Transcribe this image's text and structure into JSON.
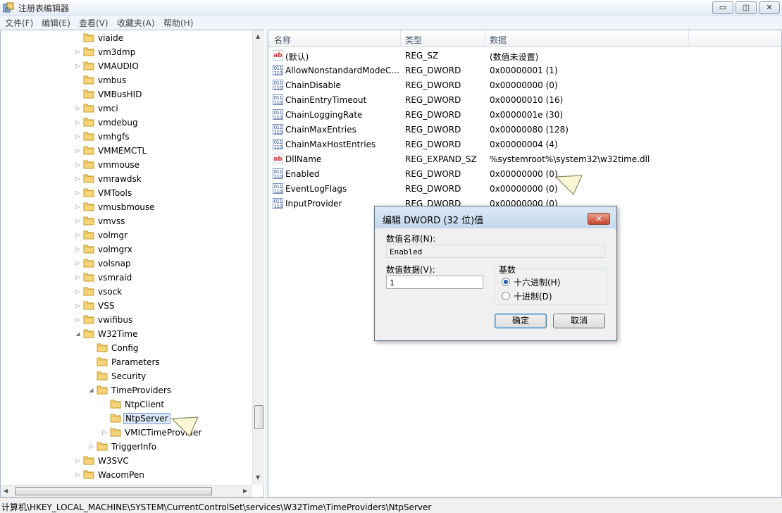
{
  "window": {
    "title": "注册表编辑器",
    "min_label": "▭",
    "max_label": "◫",
    "close_label": "✕"
  },
  "menu": [
    "文件(F)",
    "编辑(E)",
    "查看(V)",
    "收藏夹(A)",
    "帮助(H)"
  ],
  "tree": {
    "items": [
      {
        "label": "viaide",
        "expander": ""
      },
      {
        "label": "vm3dmp",
        "expander": "▷"
      },
      {
        "label": "VMAUDIO",
        "expander": "▷"
      },
      {
        "label": "vmbus",
        "expander": ""
      },
      {
        "label": "VMBusHID",
        "expander": ""
      },
      {
        "label": "vmci",
        "expander": "▷"
      },
      {
        "label": "vmdebug",
        "expander": "▷"
      },
      {
        "label": "vmhgfs",
        "expander": "▷"
      },
      {
        "label": "VMMEMCTL",
        "expander": "▷"
      },
      {
        "label": "vmmouse",
        "expander": "▷"
      },
      {
        "label": "vmrawdsk",
        "expander": "▷"
      },
      {
        "label": "VMTools",
        "expander": "▷"
      },
      {
        "label": "vmusbmouse",
        "expander": "▷"
      },
      {
        "label": "vmvss",
        "expander": "▷"
      },
      {
        "label": "volmgr",
        "expander": "▷"
      },
      {
        "label": "volmgrx",
        "expander": "▷"
      },
      {
        "label": "volsnap",
        "expander": "▷"
      },
      {
        "label": "vsmraid",
        "expander": "▷"
      },
      {
        "label": "vsock",
        "expander": "▷"
      },
      {
        "label": "VSS",
        "expander": "▷"
      },
      {
        "label": "vwifibus",
        "expander": "▷"
      },
      {
        "label": "W32Time",
        "expander": "◢"
      },
      {
        "label": "Config",
        "expander": ""
      },
      {
        "label": "Parameters",
        "expander": ""
      },
      {
        "label": "Security",
        "expander": ""
      },
      {
        "label": "TimeProviders",
        "expander": "◢"
      },
      {
        "label": "NtpClient",
        "expander": ""
      },
      {
        "label": "NtpServer",
        "expander": ""
      },
      {
        "label": "VMICTimeProvider",
        "expander": "▷"
      },
      {
        "label": "TriggerInfo",
        "expander": "▷"
      },
      {
        "label": "W3SVC",
        "expander": "▷"
      },
      {
        "label": "WacomPen",
        "expander": "▷"
      }
    ],
    "selected": "NtpServer"
  },
  "list": {
    "headers": [
      "名称",
      "类型",
      "数据"
    ],
    "rows": [
      {
        "icon": "string-value-icon",
        "icon_text": "ab",
        "name": "(默认)",
        "type": "REG_SZ",
        "data": "(数值未设置)"
      },
      {
        "icon": "binary-value-icon",
        "icon_text": "011\n110",
        "name": "AllowNonstandardModeC...",
        "type": "REG_DWORD",
        "data": "0x00000001 (1)"
      },
      {
        "icon": "binary-value-icon",
        "icon_text": "011\n110",
        "name": "ChainDisable",
        "type": "REG_DWORD",
        "data": "0x00000000 (0)"
      },
      {
        "icon": "binary-value-icon",
        "icon_text": "011\n110",
        "name": "ChainEntryTimeout",
        "type": "REG_DWORD",
        "data": "0x00000010 (16)"
      },
      {
        "icon": "binary-value-icon",
        "icon_text": "011\n110",
        "name": "ChainLoggingRate",
        "type": "REG_DWORD",
        "data": "0x0000001e (30)"
      },
      {
        "icon": "binary-value-icon",
        "icon_text": "011\n110",
        "name": "ChainMaxEntries",
        "type": "REG_DWORD",
        "data": "0x00000080 (128)"
      },
      {
        "icon": "binary-value-icon",
        "icon_text": "011\n110",
        "name": "ChainMaxHostEntries",
        "type": "REG_DWORD",
        "data": "0x00000004 (4)"
      },
      {
        "icon": "string-value-icon",
        "icon_text": "ab",
        "name": "DllName",
        "type": "REG_EXPAND_SZ",
        "data": "%systemroot%\\system32\\w32time.dll"
      },
      {
        "icon": "binary-value-icon",
        "icon_text": "011\n110",
        "name": "Enabled",
        "type": "REG_DWORD",
        "data": "0x00000000 (0)"
      },
      {
        "icon": "binary-value-icon",
        "icon_text": "011\n110",
        "name": "EventLogFlags",
        "type": "REG_DWORD",
        "data": "0x00000000 (0)"
      },
      {
        "icon": "binary-value-icon",
        "icon_text": "011\n110",
        "name": "InputProvider",
        "type": "REG_DWORD",
        "data": "0x00000000 (0)"
      }
    ]
  },
  "status": "计算机\\HKEY_LOCAL_MACHINE\\SYSTEM\\CurrentControlSet\\services\\W32Time\\TimeProviders\\NtpServer",
  "dialog": {
    "title": "编辑 DWORD (32 位)值",
    "close_label": "✕",
    "name_label": "数值名称(N):",
    "name_value": "Enabled",
    "data_label": "数值数据(V):",
    "data_value": "1",
    "base_label": "基数",
    "hex_label": "十六进制(H)",
    "dec_label": "十进制(D)",
    "selected_base": "hex",
    "ok_label": "确定",
    "cancel_label": "取消"
  },
  "colors": {
    "accent": "#3c7fb1",
    "folder": "#e8c25a",
    "selection": "#dbe7f6"
  }
}
